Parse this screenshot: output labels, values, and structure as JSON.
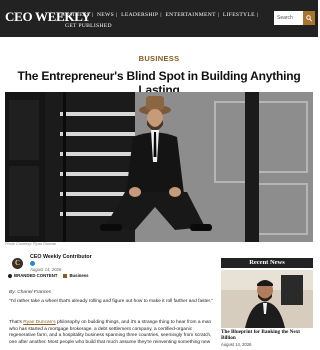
{
  "header": {
    "logo": "CEO WEEKLY",
    "nav": [
      "BUSINESS",
      "NEWS",
      "LEADERSHIP",
      "ENTERTAINMENT",
      "LIFESTYLE",
      "GET PUBLISHED"
    ],
    "search_placeholder": "Search"
  },
  "article": {
    "category": "BUSINESS",
    "title": "The Entrepreneur's Blind Spot in Building Anything Lasting",
    "photo_credit": "Photo Courtesy: Ryan Duncan",
    "author": "CEO Weekly Contributor",
    "date": "August 14, 2026",
    "badge": "BRANDED CONTENT",
    "tag": "Business",
    "byline": "By: Chanel Frances",
    "p1": "\"I'd rather take a wheel that's already rolling and figure out how to make it roll farther and faster.\"",
    "p2_pre": "That's ",
    "p2_link": "Ryan Duncan's",
    "p2_post": " philosophy on building things, and it's a strange thing to hear from a man who has started a mortgage brokerage, a debt settlement company, a certified-organic regenerative farm, and a hospitality business spanning three countries, seemingly from scratch, one after another. Most people who build that much assume they're reinventing something new"
  },
  "sidebar": {
    "heading": "Recent News",
    "item_title": "The Blueprint for Banking the Next Billion",
    "item_date": "August 14, 2026"
  }
}
